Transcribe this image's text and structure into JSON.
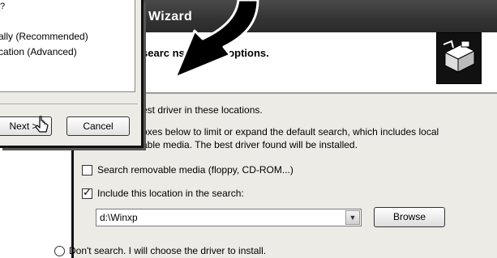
{
  "background_wizard": {
    "title": "Wizard",
    "heading": "searc    nstallation options.",
    "body_line1": "est driver in these locations.",
    "body_line2": "oxes below to limit or expand the default search, which includes local",
    "body_line3": "able media. The best driver found will be installed.",
    "checkbox_removable": {
      "label": "Search removable media (floppy, CD-ROM...)",
      "checked": false
    },
    "checkbox_location": {
      "label": "Include this location in the search:",
      "checked": true
    },
    "location_combo": {
      "value": "d:\\Winxp"
    },
    "browse_label": "Browse",
    "radio_dont_search": "Don't search. I will choose the driver to install."
  },
  "front_dialog": {
    "option_automatic": "ally (Recommended)",
    "option_specific": "cation (Advanced)",
    "top_stub": "?",
    "next_label": "Next >",
    "cancel_label": "Cancel"
  },
  "icons": [
    "hardware-icon",
    "mouse-cursor-icon",
    "pointer-arrow-icon",
    "combo-dropdown-icon"
  ]
}
